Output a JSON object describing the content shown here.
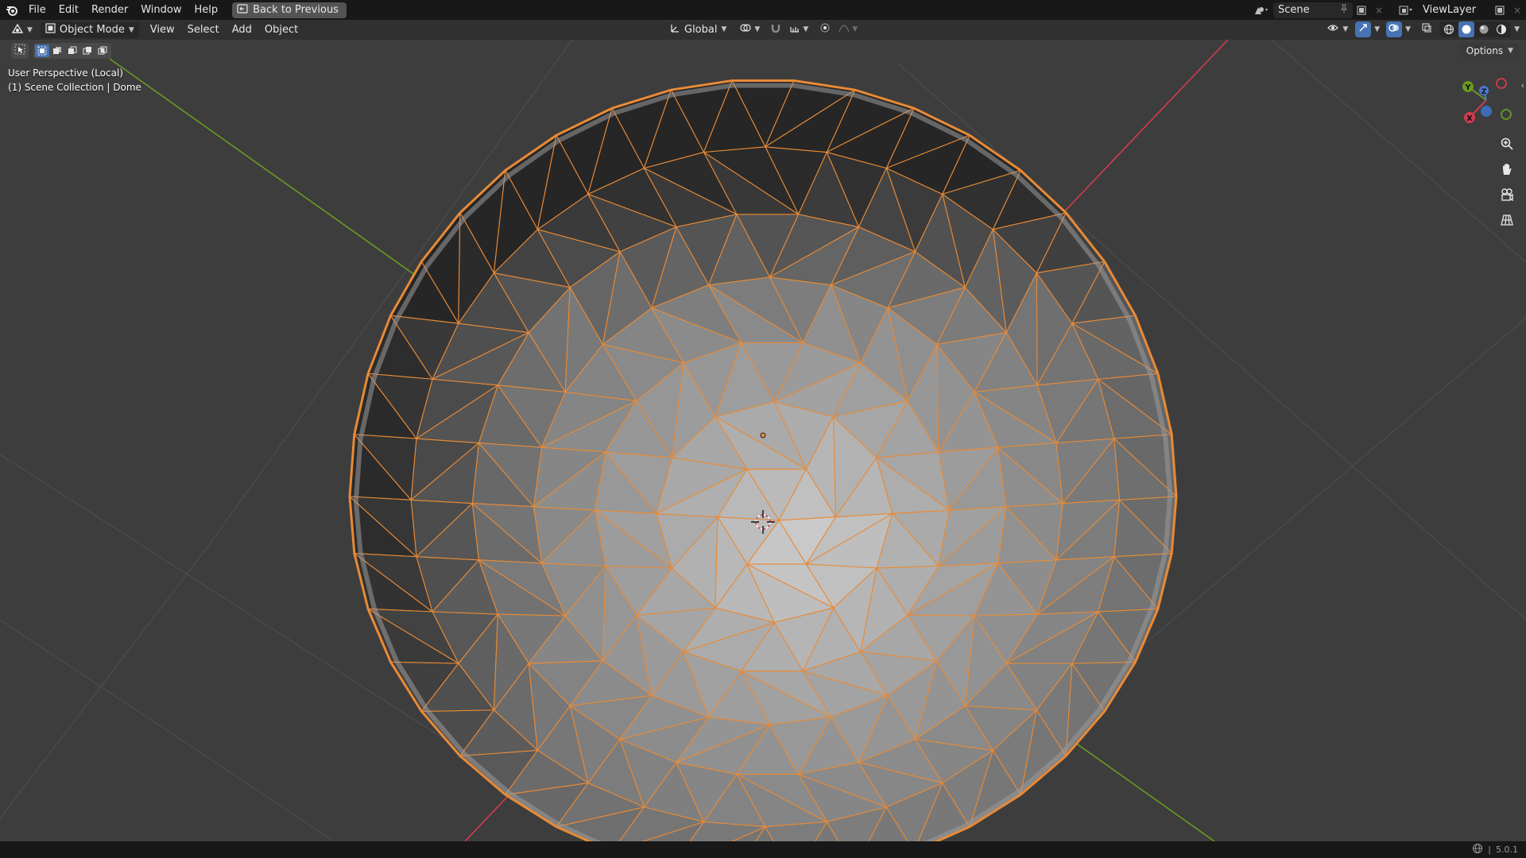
{
  "menu": [
    "File",
    "Edit",
    "Render",
    "Window",
    "Help"
  ],
  "back_button": "Back to Previous",
  "scene": {
    "name": "Scene"
  },
  "view_layer": {
    "name": "ViewLayer"
  },
  "header": {
    "mode": "Object Mode",
    "menus": [
      "View",
      "Select",
      "Add",
      "Object"
    ],
    "orientation": "Global"
  },
  "viewport": {
    "perspective_label": "User Perspective (Local)",
    "collection_label": "(1) Scene Collection | Dome",
    "options_label": "Options"
  },
  "gizmo": {
    "x": "X",
    "y": "Y",
    "z": "Z"
  },
  "status": {
    "version": "5.0.1"
  },
  "colors": {
    "selection_outline": "#e98a36",
    "x_axis": "#d23b4d",
    "y_axis": "#6a9a22",
    "active_blue": "#4772b3"
  }
}
